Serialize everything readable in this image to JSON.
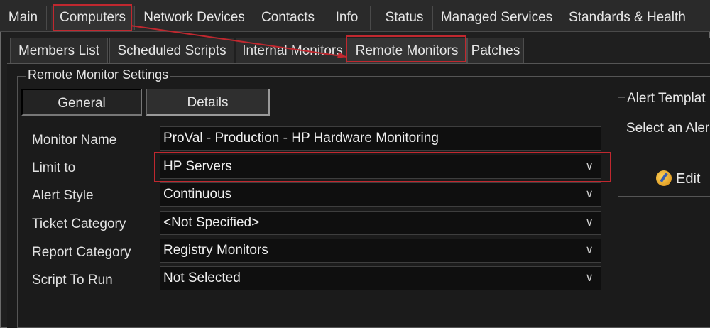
{
  "top_tabs": [
    "Main",
    "Computers",
    "Network Devices",
    "Contacts",
    "Info",
    "Status",
    "Managed Services",
    "Standards & Health"
  ],
  "sub_tabs": [
    "Members List",
    "Scheduled Scripts",
    "Internal Monitors",
    "Remote Monitors",
    "Patches"
  ],
  "group_label": "Remote Monitor Settings",
  "inner_tabs": {
    "general": "General",
    "details": "Details"
  },
  "fields": {
    "monitor_name": {
      "label": "Monitor Name",
      "value": "ProVal - Production - HP Hardware Monitoring"
    },
    "limit_to": {
      "label": "Limit to",
      "value": "HP Servers"
    },
    "alert_style": {
      "label": "Alert Style",
      "value": "Continuous"
    },
    "ticket_category": {
      "label": "Ticket Category",
      "value": "<Not Specified>"
    },
    "report_category": {
      "label": "Report Category",
      "value": "Registry Monitors"
    },
    "script_to_run": {
      "label": "Script To Run",
      "value": "Not Selected"
    }
  },
  "alert_template": {
    "title": "Alert Templat",
    "select_text": "Select an Aler",
    "edit_label": "Edit"
  },
  "chevron": "∨",
  "colors": {
    "highlight": "#c0282f",
    "background": "#1b1b1b"
  }
}
